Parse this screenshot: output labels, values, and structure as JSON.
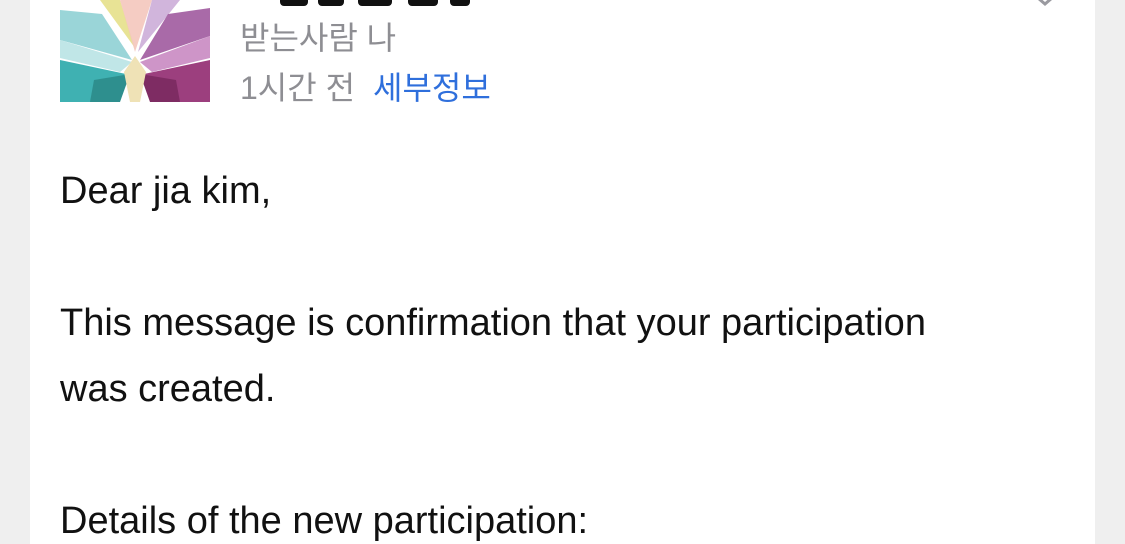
{
  "header": {
    "recipient": "받는사람 나",
    "time": "1시간 전",
    "details_link": "세부정보"
  },
  "body": {
    "greeting": "Dear jia kim,",
    "line1": "This message is confirmation that your participation",
    "line2": "was created.",
    "line3": "Details of the new participation:"
  }
}
